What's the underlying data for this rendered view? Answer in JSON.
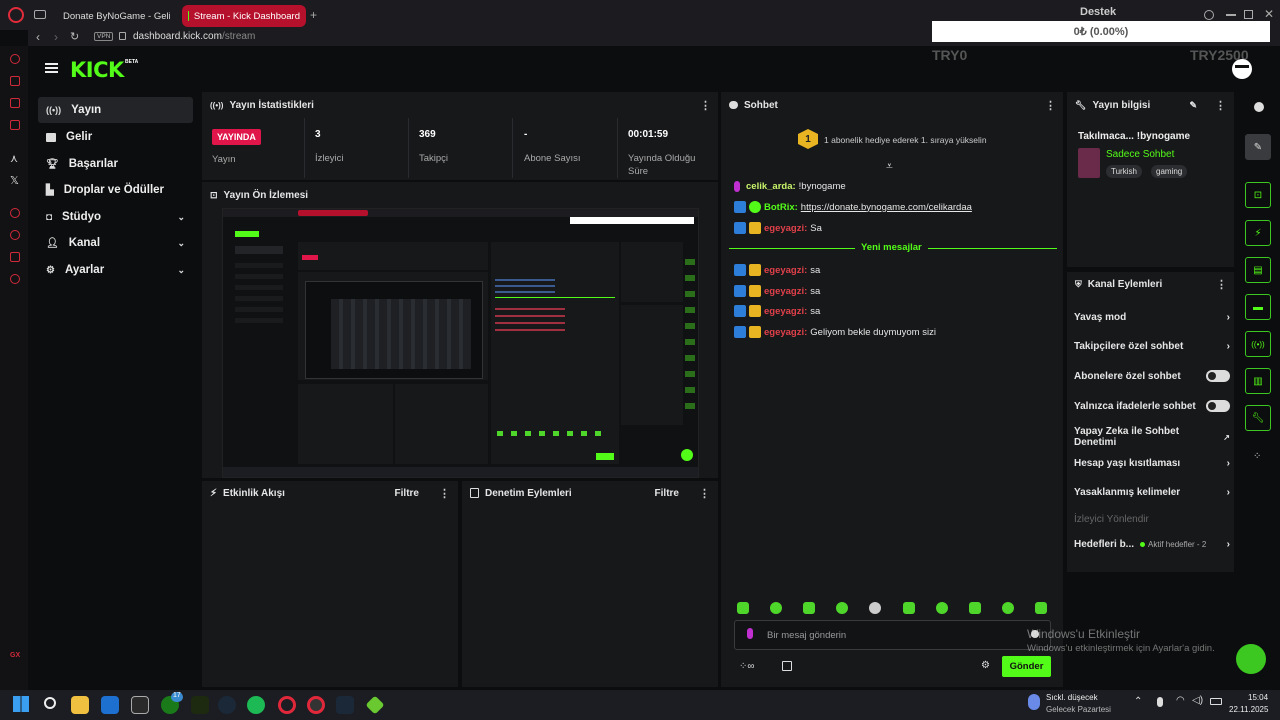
{
  "browser": {
    "tabs": [
      {
        "label": "Donate ByNoGame - Geli"
      },
      {
        "label": "Stream - Kick Dashboard"
      }
    ],
    "vpn_badge": "VPN",
    "url_domain": "dashboard.kick.com",
    "url_path": "/stream"
  },
  "donation_overlay": {
    "title": "Destek",
    "amount": "0₺ (0.00%)",
    "min": "TRY0",
    "max": "TRY2500"
  },
  "kick": {
    "logo": "KICK",
    "logo_sup": "BETA"
  },
  "sidebar": {
    "items": [
      {
        "label": "Yayın"
      },
      {
        "label": "Gelir"
      },
      {
        "label": "Başarılar"
      },
      {
        "label": "Droplar ve Ödüller"
      },
      {
        "label": "Stüdyo"
      },
      {
        "label": "Kanal"
      },
      {
        "label": "Ayarlar"
      }
    ]
  },
  "stats": {
    "title": "Yayın İstatistikleri",
    "status_badge": "YAYINDA",
    "status_label": "Yayın",
    "viewers_value": "3",
    "viewers_label": "İzleyici",
    "followers_value": "369",
    "followers_label": "Takipçi",
    "subs_value": "-",
    "subs_label": "Abone Sayısı",
    "uptime_value": "00:01:59",
    "uptime_label": "Yayında Olduğu Süre"
  },
  "preview": {
    "title": "Yayın Ön İzlemesi"
  },
  "activity": {
    "title": "Etkinlik Akışı",
    "filter": "Filtre"
  },
  "moderation": {
    "title": "Denetim Eylemleri",
    "filter": "Filtre"
  },
  "chat": {
    "title": "Sohbet",
    "gift_rank": "1",
    "gift_text": "1 abonelik hediye ederek 1. sıraya yükselin",
    "new_messages": "Yeni mesajlar",
    "messages": [
      {
        "user": "celik_arda:",
        "text": "!bynogame",
        "user_color": "#c8f56a"
      },
      {
        "user": "BotRix:",
        "text": "https://donate.bynogame.com/celikardaa",
        "user_color": "#53fc18"
      },
      {
        "user": "egeyagzi:",
        "text": "Sa",
        "user_color": "#e0404a"
      },
      {
        "user": "egeyagzi:",
        "text": "sa",
        "user_color": "#e0404a"
      },
      {
        "user": "egeyagzi:",
        "text": "sa",
        "user_color": "#e0404a"
      },
      {
        "user": "egeyagzi:",
        "text": "sa",
        "user_color": "#e0404a"
      },
      {
        "user": "egeyagzi:",
        "text": "Geliyom bekle duymuyom sizi",
        "user_color": "#e0404a"
      }
    ],
    "input_placeholder": "Bir mesaj gönderin",
    "send_label": "Gönder"
  },
  "stream_info": {
    "title": "Yayın bilgisi",
    "stream_title": "Takılmaca... !bynogame",
    "category": "Sadece Sohbet",
    "tags": [
      "Turkish",
      "gaming"
    ]
  },
  "channel_actions": {
    "title": "Kanal Eylemleri",
    "items": [
      {
        "label": "Yavaş mod"
      },
      {
        "label": "Takipçilere özel sohbet"
      },
      {
        "label": "Abonelere özel sohbet"
      },
      {
        "label": "Yalnızca ifadelerle sohbet"
      },
      {
        "label": "Yapay Zeka ile Sohbet Denetimi"
      },
      {
        "label": "Hesap yaşı kısıtlaması"
      },
      {
        "label": "Yasaklanmış kelimeler"
      },
      {
        "label": "İzleyici Yönlendir"
      },
      {
        "label": "Hedefleri b...",
        "extra": "Aktif hedefler - 2"
      }
    ]
  },
  "windows_watermark": {
    "line1": "Windows'u Etkinleştir",
    "line2": "Windows'u etkinleştirmek için Ayarlar'a gidin."
  },
  "taskbar": {
    "weather_title": "Sıckl. düşecek",
    "weather_sub": "Gelecek Pazartesi",
    "time": "15:04",
    "date": "22.11.2025",
    "notif_count": "17",
    "gx_label": "GX"
  },
  "colors": {
    "kick_green": "#53fc18",
    "live_red": "#e0154a",
    "panel_bg": "#17181a",
    "page_bg": "#0c0d0e"
  }
}
